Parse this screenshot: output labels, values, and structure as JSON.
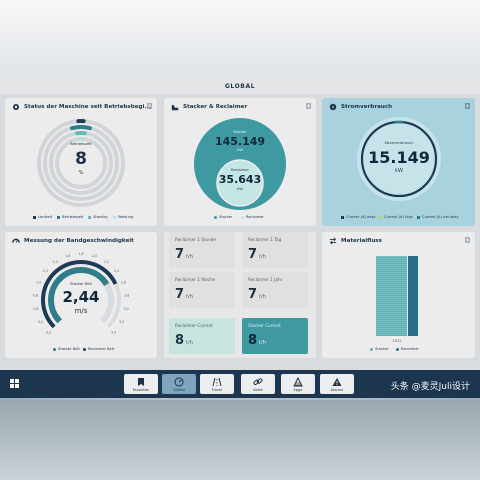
{
  "header": {
    "title": "GLOBAL"
  },
  "cards": {
    "status": {
      "title": "Status der Maschine seit Betriebsbegi...",
      "center_label": "Betriebszeit",
      "value": "8",
      "unit": "%",
      "legend": [
        "Laufzeit",
        "Betriebszeit",
        "Standby",
        "Wartung"
      ],
      "colors": [
        "#1e3b55",
        "#2f7d89",
        "#6fb3bb",
        "#b9dfe2"
      ],
      "fractions": [
        0.02,
        0.08,
        0.04,
        0.02
      ]
    },
    "stacker": {
      "title": "Stacker & Reclaimer",
      "outer_label": "Stacker",
      "outer_value": "145.149",
      "outer_unit": "kW",
      "inner_label": "Reclaimer",
      "inner_value": "35.643",
      "inner_unit": "kW",
      "legend": [
        "Stacker",
        "Reclaimer"
      ]
    },
    "strom": {
      "title": "Stromverbrauch",
      "center_label": "Stromverbrauch",
      "value": "15.149",
      "unit": "kW",
      "legend": [
        "Current (A) okay",
        "Current (A) high",
        "Current (A) not okay"
      ],
      "colors": [
        "#1e3b55",
        "#b7d96a",
        "#2f7d89"
      ]
    },
    "band": {
      "title": "Messung der Bandgeschwindigkeit",
      "center_label": "Stacker Belt",
      "value": "2,44",
      "unit": "m/s",
      "ticks": [
        "0,2",
        "0,4",
        "0,6",
        "0,8",
        "1,0",
        "1,2",
        "1,4",
        "1,6",
        "1,8",
        "2,0",
        "2,2",
        "2,4",
        "2,6",
        "2,8",
        "3,0",
        "3,2",
        "3,4"
      ],
      "legend": [
        "Stacker Belt",
        "Reclaimer Belt"
      ]
    },
    "reclaimer": {
      "tiles": [
        {
          "label": "Reclaimer 1 Stunde",
          "value": "7",
          "unit": "t/h"
        },
        {
          "label": "Reclaimer 1 Tag",
          "value": "7",
          "unit": "t/h"
        },
        {
          "label": "Reclaimer 1 Woche",
          "value": "7",
          "unit": "t/h"
        },
        {
          "label": "Reclaimer 1 Jahr",
          "value": "7",
          "unit": "t/h"
        },
        {
          "label": "Reclaimer Current",
          "value": "8",
          "unit": "t/h"
        },
        {
          "label": "Stacker Current",
          "value": "8",
          "unit": "t/h"
        }
      ]
    },
    "material": {
      "title": "Materialfluss",
      "year": "2022",
      "legend": [
        "Stacker",
        "Reclaimer"
      ]
    }
  },
  "nav": {
    "items": [
      {
        "label": "Favoriten",
        "icon": "bookmark-icon"
      },
      {
        "label": "Global",
        "icon": "gauge-icon"
      },
      {
        "label": "Travel",
        "icon": "road-icon"
      },
      {
        "label": "Kette",
        "icon": "chain-icon"
      },
      {
        "label": "Egge",
        "icon": "harrow-icon"
      },
      {
        "label": "Alarms",
        "icon": "alarm-icon"
      }
    ],
    "grid_icon": "grid-icon"
  },
  "watermark": "头条 @麦灵Juli设计"
}
